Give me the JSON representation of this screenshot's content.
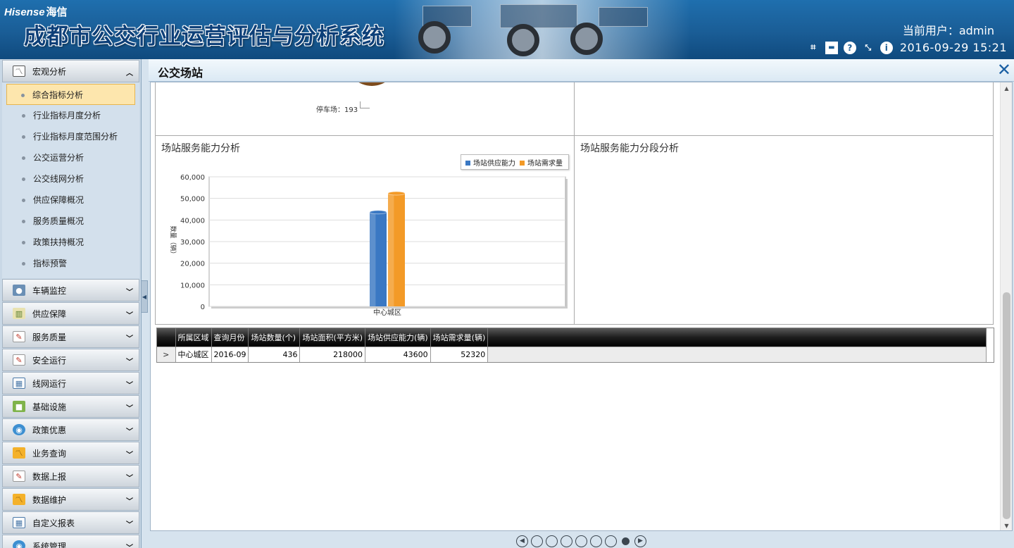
{
  "header": {
    "brand_en": "Hisense",
    "brand_cn": "海信",
    "system_title": "成都市公交行业运营评估与分析系统",
    "current_user": "当前用户：admin",
    "datetime": "2016-09-29 15:21",
    "tool_icons": [
      "crop-icon",
      "window-icon",
      "help-icon",
      "resize-icon",
      "info-icon"
    ]
  },
  "sidebar": {
    "groups": [
      {
        "label": "宏观分析",
        "icon": "chart-line-icon",
        "expanded": true
      },
      {
        "label": "车辆监控",
        "icon": "camera-icon"
      },
      {
        "label": "供应保障",
        "icon": "bar-chart-icon"
      },
      {
        "label": "服务质量",
        "icon": "edit-icon"
      },
      {
        "label": "安全运行",
        "icon": "edit-icon"
      },
      {
        "label": "线网运行",
        "icon": "calendar-icon"
      },
      {
        "label": "基础设施",
        "icon": "blocks-icon"
      },
      {
        "label": "政策优惠",
        "icon": "globe-icon"
      },
      {
        "label": "业务查询",
        "icon": "trend-icon"
      },
      {
        "label": "数据上报",
        "icon": "edit-icon"
      },
      {
        "label": "数据维护",
        "icon": "trend-icon"
      },
      {
        "label": "自定义报表",
        "icon": "calendar-icon"
      },
      {
        "label": "系统管理",
        "icon": "globe-icon"
      }
    ],
    "sub_items": [
      {
        "label": "综合指标分析",
        "active": true
      },
      {
        "label": "行业指标月度分析"
      },
      {
        "label": "行业指标月度范围分析"
      },
      {
        "label": "公交运营分析"
      },
      {
        "label": "公交线网分析"
      },
      {
        "label": "供应保障概况"
      },
      {
        "label": "服务质量概况"
      },
      {
        "label": "政策扶持概况"
      },
      {
        "label": "指标预警"
      }
    ]
  },
  "tab": {
    "title": "公交场站"
  },
  "pie": {
    "label": "停车场：193"
  },
  "panels": {
    "capacity_title": "场站服务能力分析",
    "segment_title": "场站服务能力分段分析"
  },
  "chart_data": {
    "type": "bar",
    "title": "",
    "xlabel": "",
    "ylabel": "数量（辆）",
    "categories": [
      "中心城区"
    ],
    "series": [
      {
        "name": "场站供应能力",
        "values": [
          43600
        ],
        "color": "#3a78c3"
      },
      {
        "name": "场站需求量",
        "values": [
          52320
        ],
        "color": "#f39a27"
      }
    ],
    "ylim": [
      0,
      60000
    ],
    "yticks": [
      "60,000",
      "50,000",
      "40,000",
      "30,000",
      "20,000",
      "10,000",
      "0"
    ],
    "grid": true,
    "legend": "top-right"
  },
  "grid": {
    "headers": [
      "所属区域",
      "查询月份",
      "场站数量(个)",
      "场站面积(平方米)",
      "场站供应能力(辆)",
      "场站需求量(辆)"
    ],
    "rows": [
      [
        "中心城区",
        "2016-09",
        "436",
        "218000",
        "43600",
        "52320"
      ]
    ],
    "row_marker": ">"
  },
  "pager": {
    "pages": 7,
    "active_index": 7
  }
}
